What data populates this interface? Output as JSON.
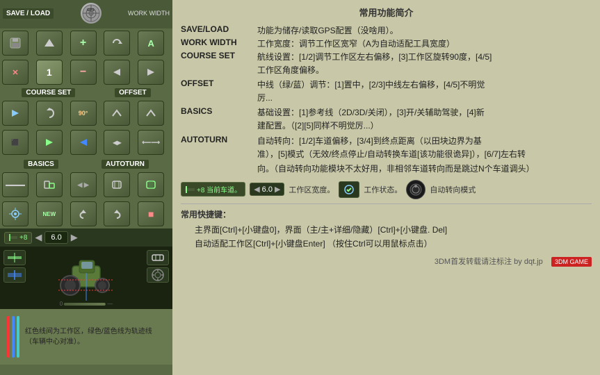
{
  "left": {
    "save_load_label": "SAVE / LOAD",
    "gps_text": "GPS",
    "work_width_label": "WORK WIDTH",
    "course_set_label": "COURSE SET",
    "offset_label": "OFFSET",
    "basics_label": "BASICS",
    "autoturn_label": "AUTOTURN",
    "status_plus8": "+8",
    "width_value": "6.0",
    "bottom_description": "红色线间为工作区，绿色/蓝色线为轨迹线（车辆中心对准）。"
  },
  "right": {
    "title": "常用功能简介",
    "sections": [
      {
        "key": "SAVE/LOAD",
        "value": "功能为储存/读取GPS配置（没啥用）。"
      },
      {
        "key": "WORK WIDTH",
        "value": "工作宽度：调节工作区宽窄（A为自动适配工具宽度）"
      },
      {
        "key": "COURSE SET",
        "value": "航线设置：[1/2]调节工作区左右偏移，[3]工作区旋转90度，[4/5]",
        "indent": "工作区角度偏移。"
      },
      {
        "key": "OFFSET",
        "value": "中线（绿/蓝）调节：[1]置中，[2/3]中线左右偏移，[4/5]不明觉",
        "indent": "厉..."
      },
      {
        "key": "BASICS",
        "value": "基础设置：[1]参考线（2D/3D/关闭），[3]开/关辅助驾驶，[4]新",
        "indent": "建配置。（[2][5]同样不明觉厉...）"
      },
      {
        "key": "AUTOTURN",
        "value": "自动转向：[1/2]车道偏移，[3/4]到终点距离（以田块边界为基",
        "indent": "准），[5]模式（无效/终点停止/自动转换车道[该功能很诡异]），[6/7]左右转",
        "indent2": "向。（自动转向功能模块不太好用，非相邻车道转向而是跳过N个车道调头）"
      }
    ],
    "status_bar_label1": "+8 当前车道。",
    "status_bar_label2": "6.0",
    "status_bar_label3": "工作区宽度。",
    "status_bar_label4": "工作状态。",
    "status_bar_label5": "自动转向模式",
    "shortcuts_title": "常用快捷键：",
    "shortcut1": "主界面[Ctrl]+[小键盘0]，界面（主/主+详细/隐藏）[Ctrl]+[小键盘. Del]",
    "shortcut2": "自动适配工作区[Ctrl]+[小键盘Enter]        （按住Ctrl可以用鼠标点击）",
    "credit": "3DM首发转载请注标注 by dqt.jp",
    "watermark": "3DM GAME"
  }
}
